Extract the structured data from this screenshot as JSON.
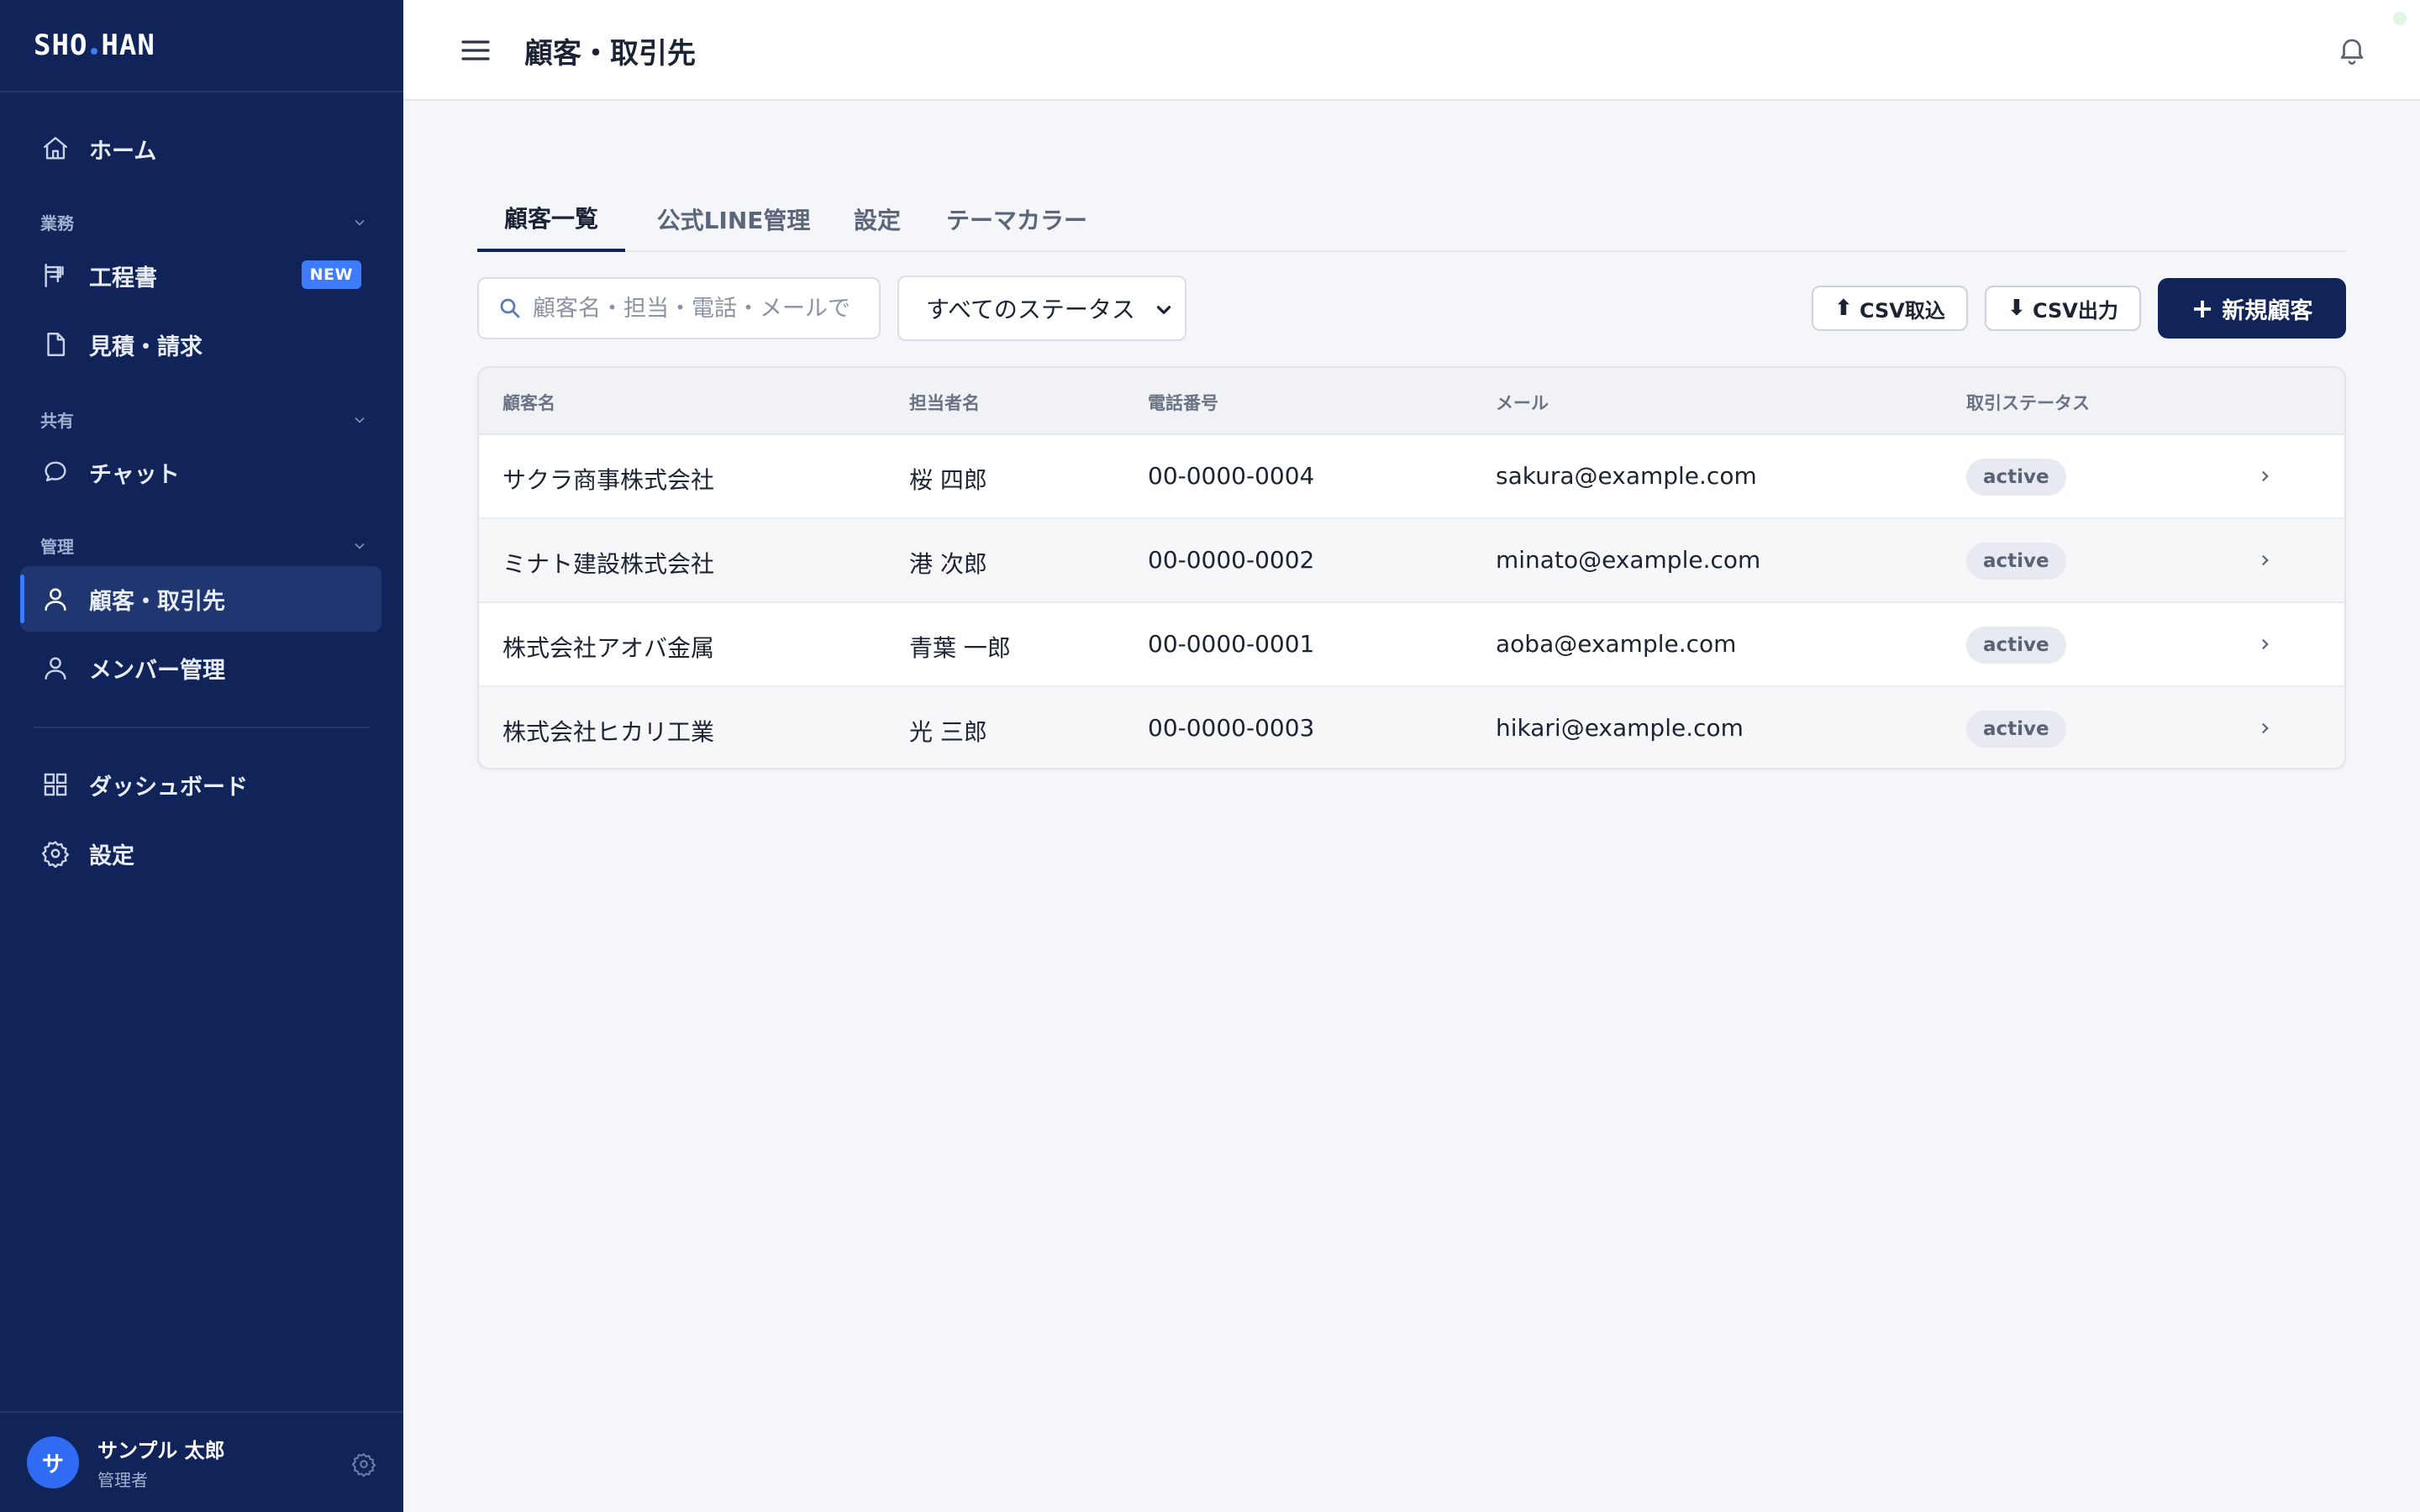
{
  "app": {
    "logo_left": "SHO",
    "logo_right": "HAN",
    "accent": "#3d7bff",
    "sidebar_bg": "#11245a"
  },
  "sidebar": {
    "home": "ホーム",
    "sections": {
      "work": "業務",
      "shared": "共有",
      "admin": "管理"
    },
    "items": {
      "schedule": "工程書",
      "schedule_badge": "NEW",
      "estimate": "見積・請求",
      "chat": "チャット",
      "customers": "顧客・取引先",
      "members": "メンバー管理",
      "dashboard": "ダッシュボード",
      "settings": "設定"
    },
    "user": {
      "avatar_initial": "サ",
      "name": "サンプル 太郎",
      "role": "管理者"
    }
  },
  "header": {
    "title": "顧客・取引先"
  },
  "tabs": [
    {
      "label": "顧客一覧",
      "active": true
    },
    {
      "label": "公式LINE管理",
      "active": false
    },
    {
      "label": "設定",
      "active": false
    },
    {
      "label": "テーマカラー",
      "active": false
    }
  ],
  "toolbar": {
    "search_placeholder": "顧客名・担当・電話・メールで",
    "status_selected": "すべてのステータス",
    "csv_import": "CSV取込",
    "csv_export": "CSV出力",
    "new_customer": "新規顧客"
  },
  "table": {
    "columns": [
      "顧客名",
      "担当者名",
      "電話番号",
      "メール",
      "取引ステータス"
    ],
    "rows": [
      {
        "name": "サクラ商事株式会社",
        "contact": "桜 四郎",
        "phone": "00-0000-0004",
        "email": "sakura@example.com",
        "status": "active"
      },
      {
        "name": "ミナト建設株式会社",
        "contact": "港 次郎",
        "phone": "00-0000-0002",
        "email": "minato@example.com",
        "status": "active"
      },
      {
        "name": "株式会社アオバ金属",
        "contact": "青葉 一郎",
        "phone": "00-0000-0001",
        "email": "aoba@example.com",
        "status": "active"
      },
      {
        "name": "株式会社ヒカリ工業",
        "contact": "光 三郎",
        "phone": "00-0000-0003",
        "email": "hikari@example.com",
        "status": "active"
      }
    ]
  }
}
